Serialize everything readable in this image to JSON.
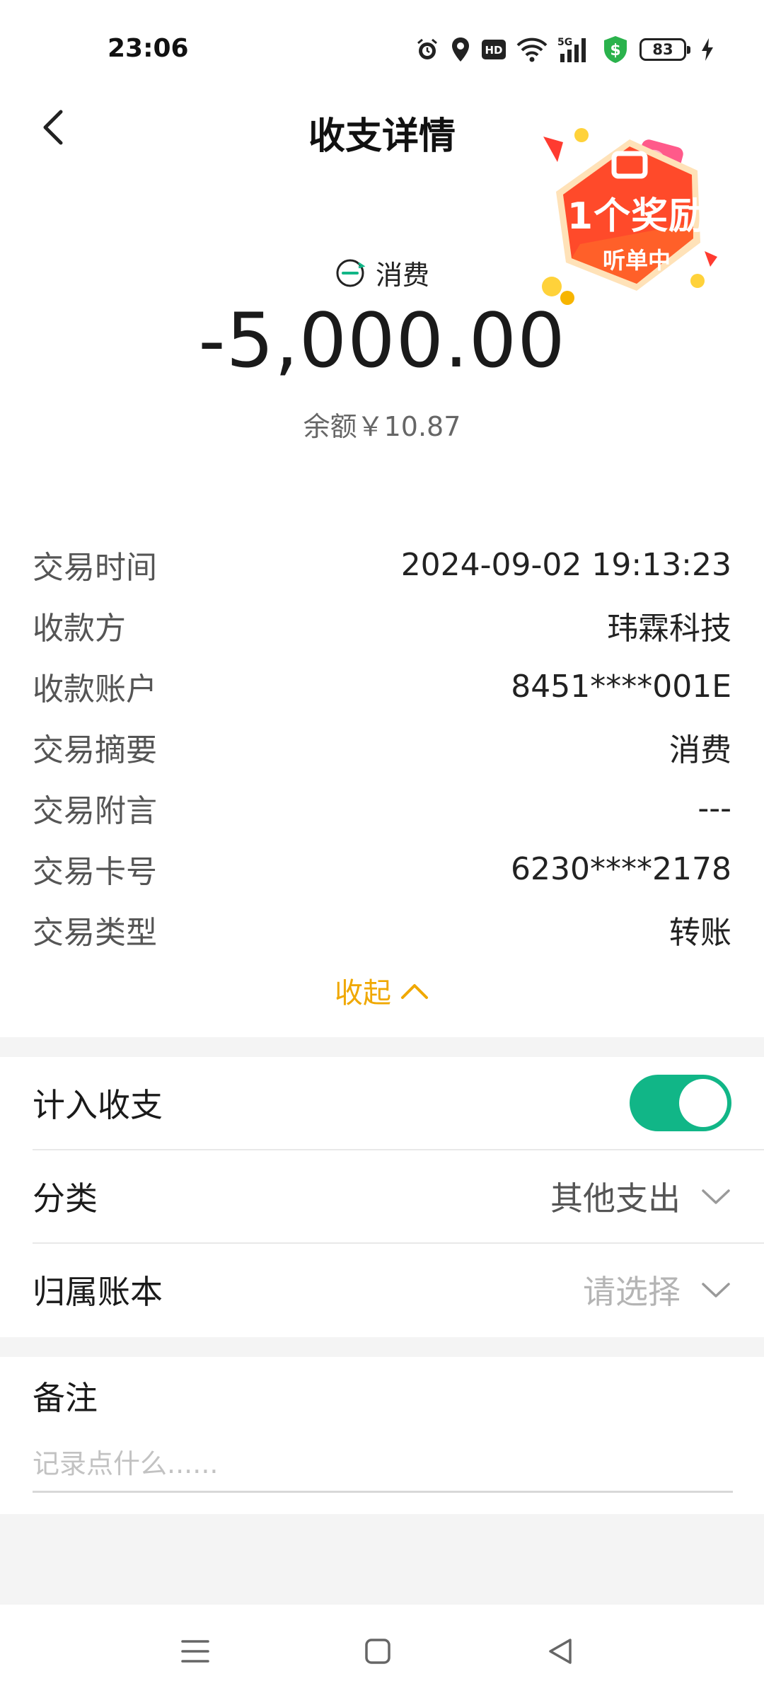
{
  "status_bar": {
    "time": "23:06",
    "battery": "83",
    "icons": [
      "alarm-icon",
      "location-icon",
      "hd-icon",
      "wifi-icon",
      "5g-signal-icon",
      "shield-dollar-icon",
      "battery-icon",
      "charging-icon"
    ]
  },
  "header": {
    "title": "收支详情",
    "back_icon": "chevron-left-icon"
  },
  "promo": {
    "title": "1个奖励",
    "subtitle": "听单中",
    "color": "#ff4a2a"
  },
  "summary": {
    "type_label": "消费",
    "amount": "-5,000.00",
    "balance": "余额￥10.87"
  },
  "details": [
    {
      "label": "交易时间",
      "value": "2024-09-02 19:13:23"
    },
    {
      "label": "收款方",
      "value": "玮霖科技"
    },
    {
      "label": "收款账户",
      "value": "8451****001E"
    },
    {
      "label": "交易摘要",
      "value": "消费"
    },
    {
      "label": "交易附言",
      "value": "---"
    },
    {
      "label": "交易卡号",
      "value": "6230****2178"
    },
    {
      "label": "交易类型",
      "value": "转账"
    }
  ],
  "collapse": {
    "label": "收起",
    "color": "#f0a800"
  },
  "settings": {
    "include_label": "计入收支",
    "include_on": true,
    "toggle_color": "#11b687",
    "category_label": "分类",
    "category_value": "其他支出",
    "ledger_label": "归属账本",
    "ledger_placeholder": "请选择"
  },
  "remark": {
    "label": "备注",
    "placeholder": "记录点什么......",
    "value": ""
  },
  "nav_bar": {
    "buttons": [
      "menu-icon",
      "home-square-icon",
      "back-triangle-icon"
    ]
  }
}
